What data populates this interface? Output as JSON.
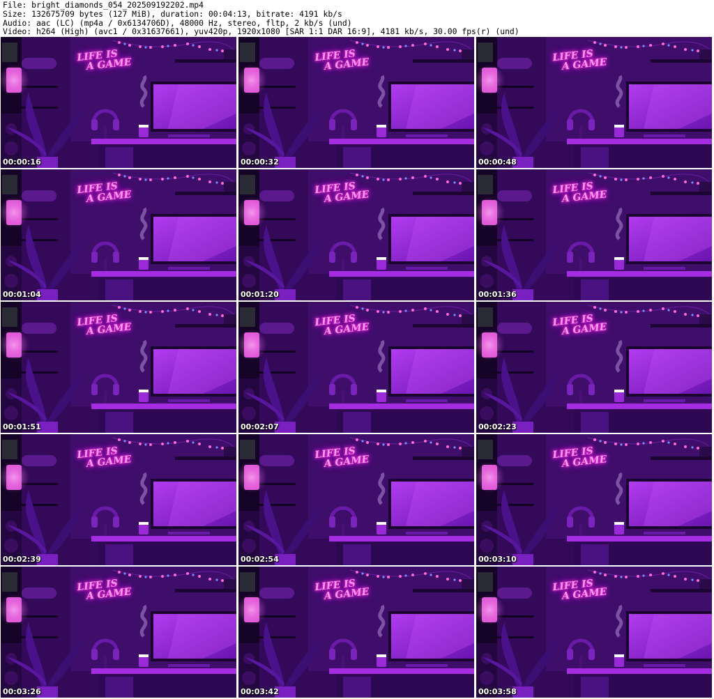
{
  "header": {
    "line1": "File: bright_diamonds_054_202509192202.mp4",
    "line2": "Size: 132675709 bytes (127 MiB), duration: 00:04:13, bitrate: 4191 kb/s",
    "line3": "Audio: aac (LC) (mp4a / 0x6134706D), 48000 Hz, stereo, fltp, 2 kb/s (und)",
    "line4": "Video: h264 (High) (avc1 / 0x31637661), yuv420p, 1920x1080 [SAR 1:1 DAR 16:9], 4181 kb/s, 30.00 fps(r) (und)"
  },
  "scene": {
    "neon_line1": "LIFE IS",
    "neon_line2": "A GAME",
    "colors": {
      "neon": "#ff9bf0",
      "wall": "#3d0d62",
      "monitor": "#8b1fd6",
      "desk": "#a52ce0"
    }
  },
  "thumbnails": [
    {
      "timestamp": "00:00:16"
    },
    {
      "timestamp": "00:00:32"
    },
    {
      "timestamp": "00:00:48"
    },
    {
      "timestamp": "00:01:04"
    },
    {
      "timestamp": "00:01:20"
    },
    {
      "timestamp": "00:01:36"
    },
    {
      "timestamp": "00:01:51"
    },
    {
      "timestamp": "00:02:07"
    },
    {
      "timestamp": "00:02:23"
    },
    {
      "timestamp": "00:02:39"
    },
    {
      "timestamp": "00:02:54"
    },
    {
      "timestamp": "00:03:10"
    },
    {
      "timestamp": "00:03:26"
    },
    {
      "timestamp": "00:03:42"
    },
    {
      "timestamp": "00:03:58"
    }
  ]
}
